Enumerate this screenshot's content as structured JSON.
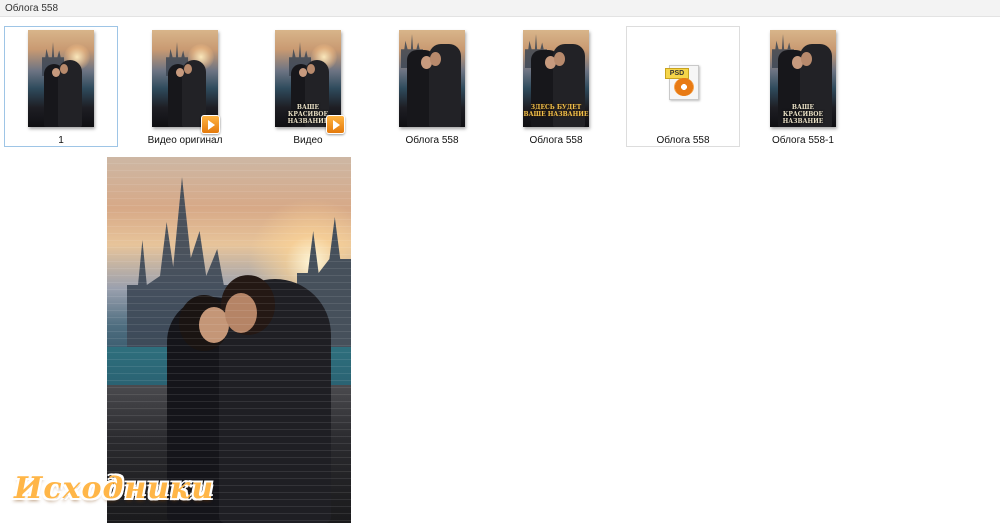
{
  "window": {
    "title": "Облога 558"
  },
  "files": [
    {
      "name": "1",
      "type": "image",
      "selected": true
    },
    {
      "name": "Видео оригинал",
      "type": "video"
    },
    {
      "name": "Видео",
      "type": "video",
      "cover_text": "ВАШЕ КРАСИВОЕ НАЗВАНИЕ"
    },
    {
      "name": "Облога  558",
      "type": "image"
    },
    {
      "name": "Облога 558",
      "type": "image",
      "cover_text": "ЗДЕСЬ БУДЕТ ВАШЕ НАЗВАНИЕ"
    },
    {
      "name": "Облога 558",
      "type": "psd",
      "icon": "psd-file-icon",
      "badge": "PSD"
    },
    {
      "name": "Облога 558-1",
      "type": "image",
      "cover_text": "ВАШЕ КРАСИВОЕ НАЗВАНИЕ"
    }
  ],
  "preview": {
    "description_icon": "preview-image"
  },
  "watermark": {
    "text": "Исходники"
  },
  "colors": {
    "selection_border": "#9ec5e6",
    "play_badge": "#f39a1f",
    "watermark": "#ffb648"
  }
}
